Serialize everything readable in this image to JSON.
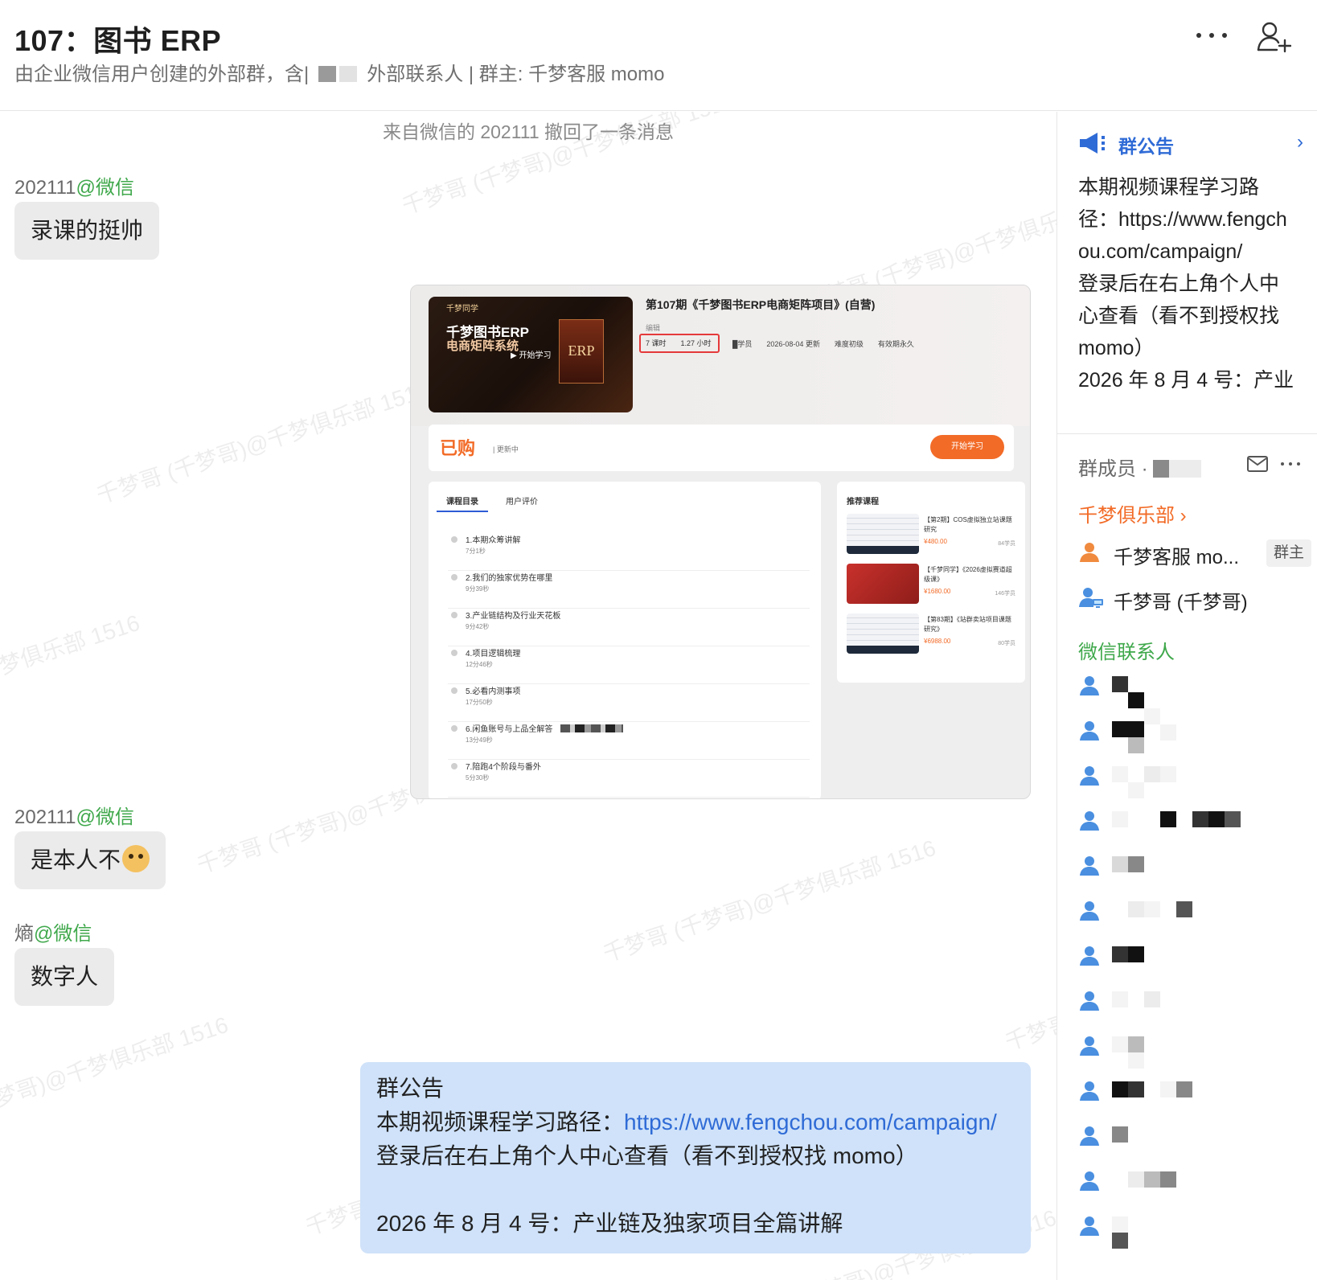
{
  "header": {
    "title": "107：图书 ERP",
    "subtitle_prefix": "由企业微信用户创建的外部群，含|",
    "subtitle_suffix": "外部联系人 | 群主: 千梦客服 momo",
    "more_icon": "more-icon",
    "add_member_icon": "add-member-icon"
  },
  "watermark_text": "千梦哥 (千梦哥)@千梦俱乐部 1516",
  "chat": {
    "recall_notice": "来自微信的 202111 撤回了一条消息",
    "messages": [
      {
        "sender": "202111",
        "via": "@微信",
        "text": "录课的挺帅"
      },
      {
        "sender": "202111",
        "via": "@微信",
        "text": "是本人不"
      },
      {
        "sender": "熵",
        "via": "@微信",
        "text": "数字人"
      }
    ],
    "screenshot": {
      "cover_brand": "千梦同学",
      "cover_title_1": "千梦图书ERP",
      "cover_title_2": "电商矩阵系统",
      "cover_erp": "ERP",
      "cover_play": "▶ 开始学习",
      "course_title": "第107期《千梦图书ERP电商矩阵项目》(自营)",
      "edit_label": "编辑",
      "lessons": "7 课时　　1.27 小时",
      "meta": "█学员　　2026-08-04 更新　　难度初级　　有效期永久",
      "bought": "已购",
      "bought_sub": "| 更新中",
      "start_button": "开始学习",
      "tab_catalog": "课程目录",
      "tab_reviews": "用户评价",
      "toc": [
        {
          "name": "1.本期众筹讲解",
          "duration": "7分1秒"
        },
        {
          "name": "2.我们的独家优势在哪里",
          "duration": "9分39秒"
        },
        {
          "name": "3.产业链结构及行业天花板",
          "duration": "9分42秒"
        },
        {
          "name": "4.项目逻辑梳理",
          "duration": "12分46秒"
        },
        {
          "name": "5.必看内测事项",
          "duration": "17分50秒"
        },
        {
          "name": "6.闲鱼账号与上品全解答",
          "duration": "13分49秒"
        },
        {
          "name": "7.陪跑4个阶段与番外",
          "duration": "5分30秒"
        }
      ],
      "rec_title": "推荐课程",
      "recommended": [
        {
          "name": "【第2期】COS虚拟独立站课题研究",
          "price": "¥480.00",
          "students": "84学员"
        },
        {
          "name": "【千梦同学】《2026虚拟赛道超级课》",
          "price": "¥1680.00",
          "students": "146学员"
        },
        {
          "name": "【第83期】《站群卖站项目课题研究》",
          "price": "¥6988.00",
          "students": "80学员"
        }
      ]
    },
    "notice": {
      "title": "群公告",
      "line1_prefix": "本期视频课程学习路径：",
      "link": "https://www.fengchou.com/campaign/",
      "line2": "登录后在右上角个人中心查看（看不到授权找 momo）",
      "line3": "2026 年 8 月 4 号：产业链及独家项目全篇讲解"
    }
  },
  "sidebar": {
    "announcement_title": "群公告",
    "announcement_icon": "megaphone-icon",
    "announcement_text": "本期视频课程学习路径：https://www.fengchou.com/campaign/\n登录后在右上角个人中心查看（看不到授权找 momo）\n2026 年 8 月 4 号：产业",
    "members_label": "群成员 ·",
    "club_link": "千梦俱乐部 ›",
    "members": [
      {
        "name": "千梦客服 mo...",
        "badge": "群主",
        "icon": "person-orange-icon"
      },
      {
        "name": "千梦哥 (千梦哥)",
        "badge": "",
        "icon": "person-computer-icon"
      }
    ],
    "wechat_contacts_label": "微信联系人",
    "contact_count": 13
  },
  "colors": {
    "wechat_green": "#3fa84b",
    "link_blue": "#2f6bd6",
    "orange": "#f26b27",
    "notice_bg": "#cfe2f9",
    "bubble_bg": "#ebebeb"
  }
}
